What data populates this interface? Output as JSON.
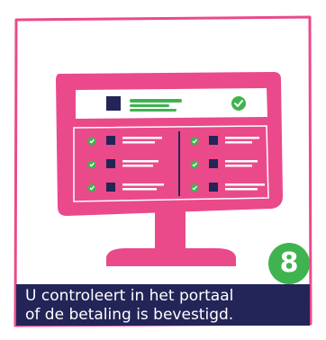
{
  "step": {
    "number": "8",
    "caption_line1": "U controleert in het portaal",
    "caption_line2": "of de betaling is bevestigd."
  },
  "colors": {
    "pink": "#ea4a8a",
    "navy": "#232457",
    "green": "#3fb34f",
    "white": "#ffffff"
  },
  "illustration": {
    "subject": "monitor-with-payment-portal",
    "header_status": "confirmed-check-icon",
    "list_rows_per_column": 3,
    "list_columns": 2
  }
}
